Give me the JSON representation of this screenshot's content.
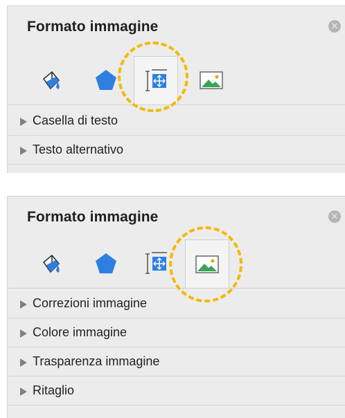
{
  "panels": [
    {
      "title": "Formato immagine",
      "close_icon": "close-circle-icon",
      "tabs": [
        {
          "icon": "fill-bucket-icon",
          "selected": false
        },
        {
          "icon": "pentagon-shape-icon",
          "selected": false
        },
        {
          "icon": "size-position-icon",
          "selected": true
        },
        {
          "icon": "picture-icon",
          "selected": false
        }
      ],
      "sections": [
        {
          "label": "Casella di testo"
        },
        {
          "label": "Testo alternativo"
        }
      ]
    },
    {
      "title": "Formato immagine",
      "close_icon": "close-circle-icon",
      "tabs": [
        {
          "icon": "fill-bucket-icon",
          "selected": false
        },
        {
          "icon": "pentagon-shape-icon",
          "selected": false
        },
        {
          "icon": "size-position-icon",
          "selected": false
        },
        {
          "icon": "picture-icon",
          "selected": true
        }
      ],
      "sections": [
        {
          "label": "Correzioni immagine"
        },
        {
          "label": "Colore immagine"
        },
        {
          "label": "Trasparenza immagine"
        },
        {
          "label": "Ritaglio"
        }
      ]
    }
  ],
  "colors": {
    "panel_bg": "#ececec",
    "accent_blue": "#2f7fe0",
    "highlight": "#f5b800",
    "picture_green": "#3aa55a"
  }
}
